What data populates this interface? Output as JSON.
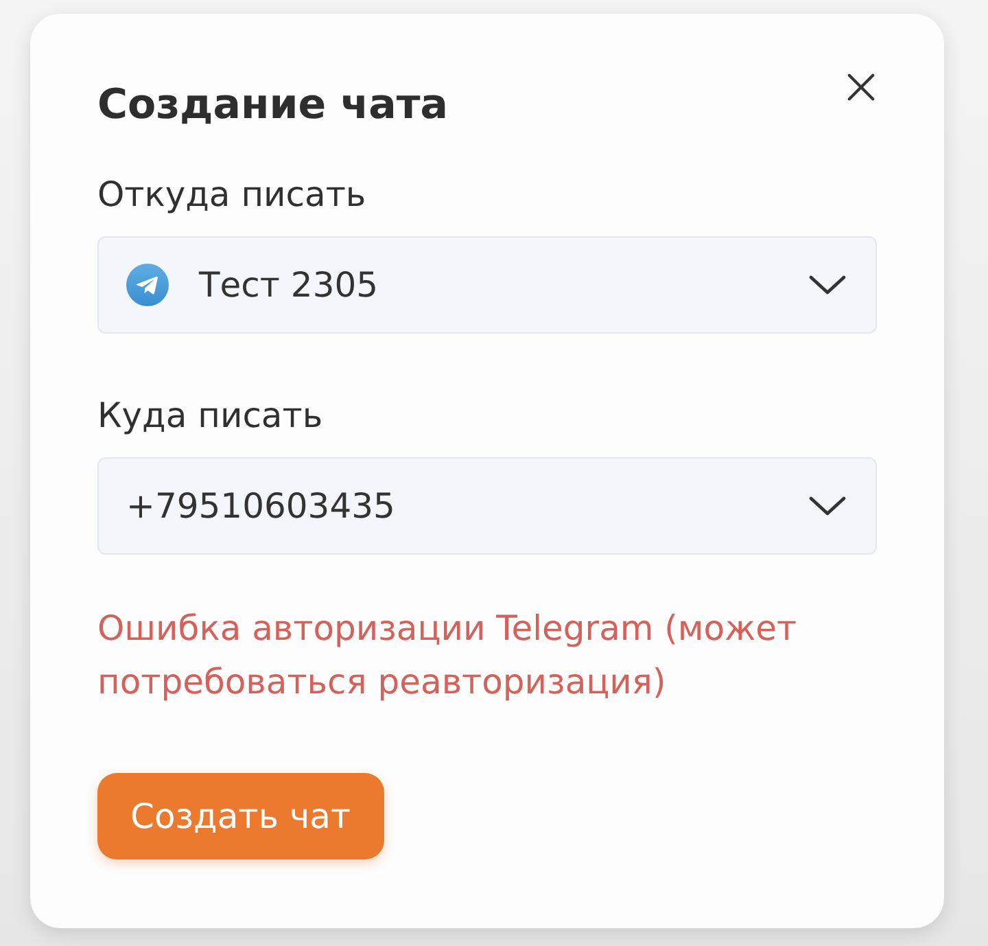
{
  "dialog": {
    "title": "Создание чата"
  },
  "fields": [
    {
      "kind": "channel",
      "label": "Откуда писать",
      "value": "Тест 2305"
    },
    {
      "kind": "plain",
      "label": "Куда писать",
      "value": "+79510603435"
    }
  ],
  "error": "Ошибка авторизации Telegram (может потребоваться реавторизация)",
  "submit_button": "Создать чат"
}
